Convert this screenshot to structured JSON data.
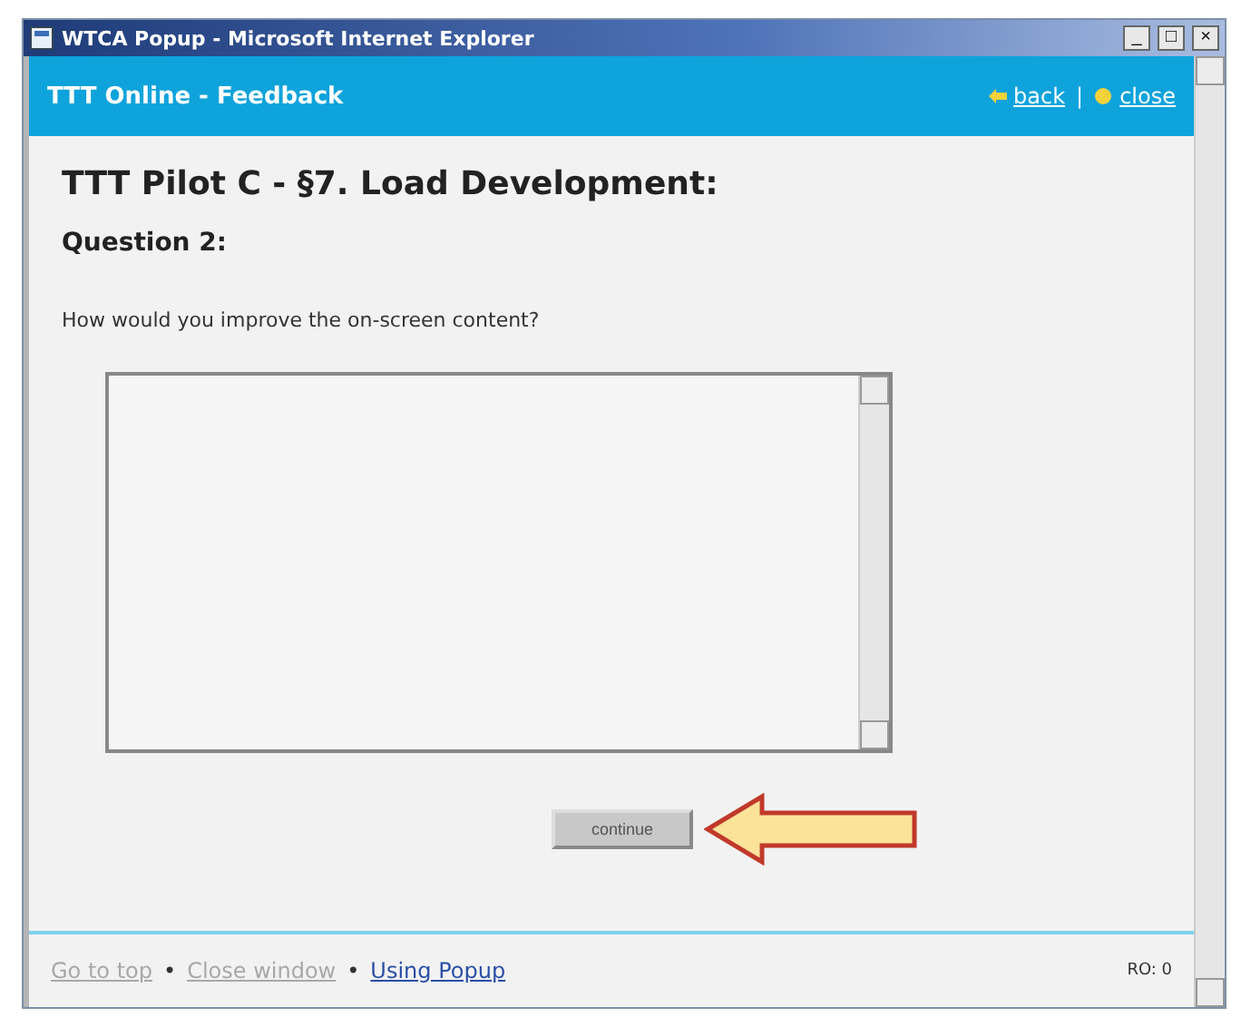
{
  "window": {
    "title": "WTCA Popup - Microsoft Internet Explorer",
    "controls": [
      "_",
      "□",
      "×"
    ]
  },
  "header": {
    "title": "TTT Online - Feedback",
    "links": [
      {
        "label": "back",
        "kind": "arrow"
      },
      {
        "label": "close",
        "kind": "dot"
      }
    ],
    "separator": "|"
  },
  "heading": "TTT Pilot C - §7. Load Development:",
  "question": "Question 2:",
  "prompt": "How would you improve the on-screen content?",
  "button": "continue",
  "footer": {
    "links": [
      {
        "label": "Go to top",
        "visited": true
      },
      {
        "label": "Close window",
        "visited": true
      },
      {
        "label": "Using Popup",
        "visited": false
      }
    ],
    "separator": "•",
    "code": "RO: 0"
  }
}
